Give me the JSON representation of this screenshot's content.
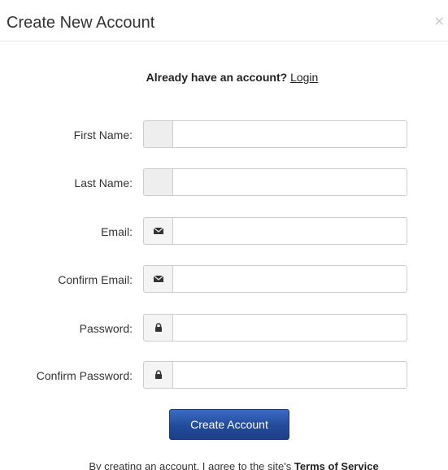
{
  "modal": {
    "title": "Create New Account",
    "close_label": "×"
  },
  "login_prompt": {
    "text": "Already have an account?",
    "link_label": "Login"
  },
  "form": {
    "fields": [
      {
        "label": "First Name:",
        "value": "",
        "icon": "none"
      },
      {
        "label": "Last Name:",
        "value": "",
        "icon": "none"
      },
      {
        "label": "Email:",
        "value": "",
        "icon": "envelope-icon"
      },
      {
        "label": "Confirm Email:",
        "value": "",
        "icon": "envelope-icon"
      },
      {
        "label": "Password:",
        "value": "",
        "icon": "lock-icon"
      },
      {
        "label": "Confirm Password:",
        "value": "",
        "icon": "lock-icon"
      }
    ],
    "submit_label": "Create Account"
  },
  "terms": {
    "prefix": "By creating an account, I agree to the site's",
    "link_label": "Terms of Service"
  },
  "colors": {
    "button_primary": "#234b9a",
    "border": "#cccccc",
    "addon_background": "#eeeeee"
  }
}
